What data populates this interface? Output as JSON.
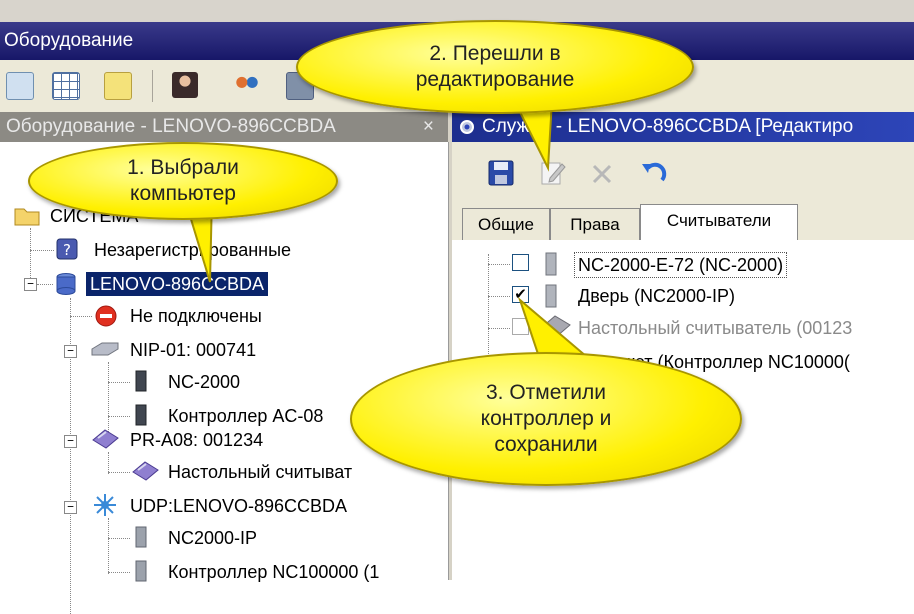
{
  "window": {
    "title": "Оборудование"
  },
  "left_panel": {
    "header": "Оборудование - LENOVO-896CCBDA",
    "close_glyph": "×"
  },
  "right_panel": {
    "header": "Служба - LENOVO-896CCBDA [Редактиро"
  },
  "tree": {
    "root": "СИСТЕМА",
    "unregistered": "Незарегистрированные",
    "computer": "LENOVO-896CCBDA",
    "not_connected": "Не подключены",
    "nip": "NIP-01: 000741",
    "nc2000": "NC-2000",
    "ac08": "Контроллер AC-08",
    "pra08": "PR-A08: 001234",
    "desktop_reader": "Настольный считыват",
    "udp": "UDP:LENOVO-896CCBDA",
    "nc2000ip": "NC2000-IP",
    "nc100000": "Контроллер NC100000 (1"
  },
  "tabs": [
    {
      "label": "Общие"
    },
    {
      "label": "Права"
    },
    {
      "label": "Считыватели"
    }
  ],
  "readers": [
    {
      "label": "NC-2000-E-72 (NC-2000)",
      "checked": false
    },
    {
      "label": "Дверь (NC2000-IP)",
      "checked": true
    },
    {
      "label": "Настольный считыватель (00123",
      "checked": false
    },
    {
      "label": "Турникет (Контроллер NC10000(",
      "checked": false
    }
  ],
  "callouts": {
    "step1": "1. Выбрали компьютер",
    "step2": "2. Перешли в редактирование",
    "step3": "3. Отметили контроллер и сохранили"
  },
  "colors": {
    "selection": "#0a246a",
    "balloon": "#fff000",
    "right_header": "#1d2e8e"
  }
}
